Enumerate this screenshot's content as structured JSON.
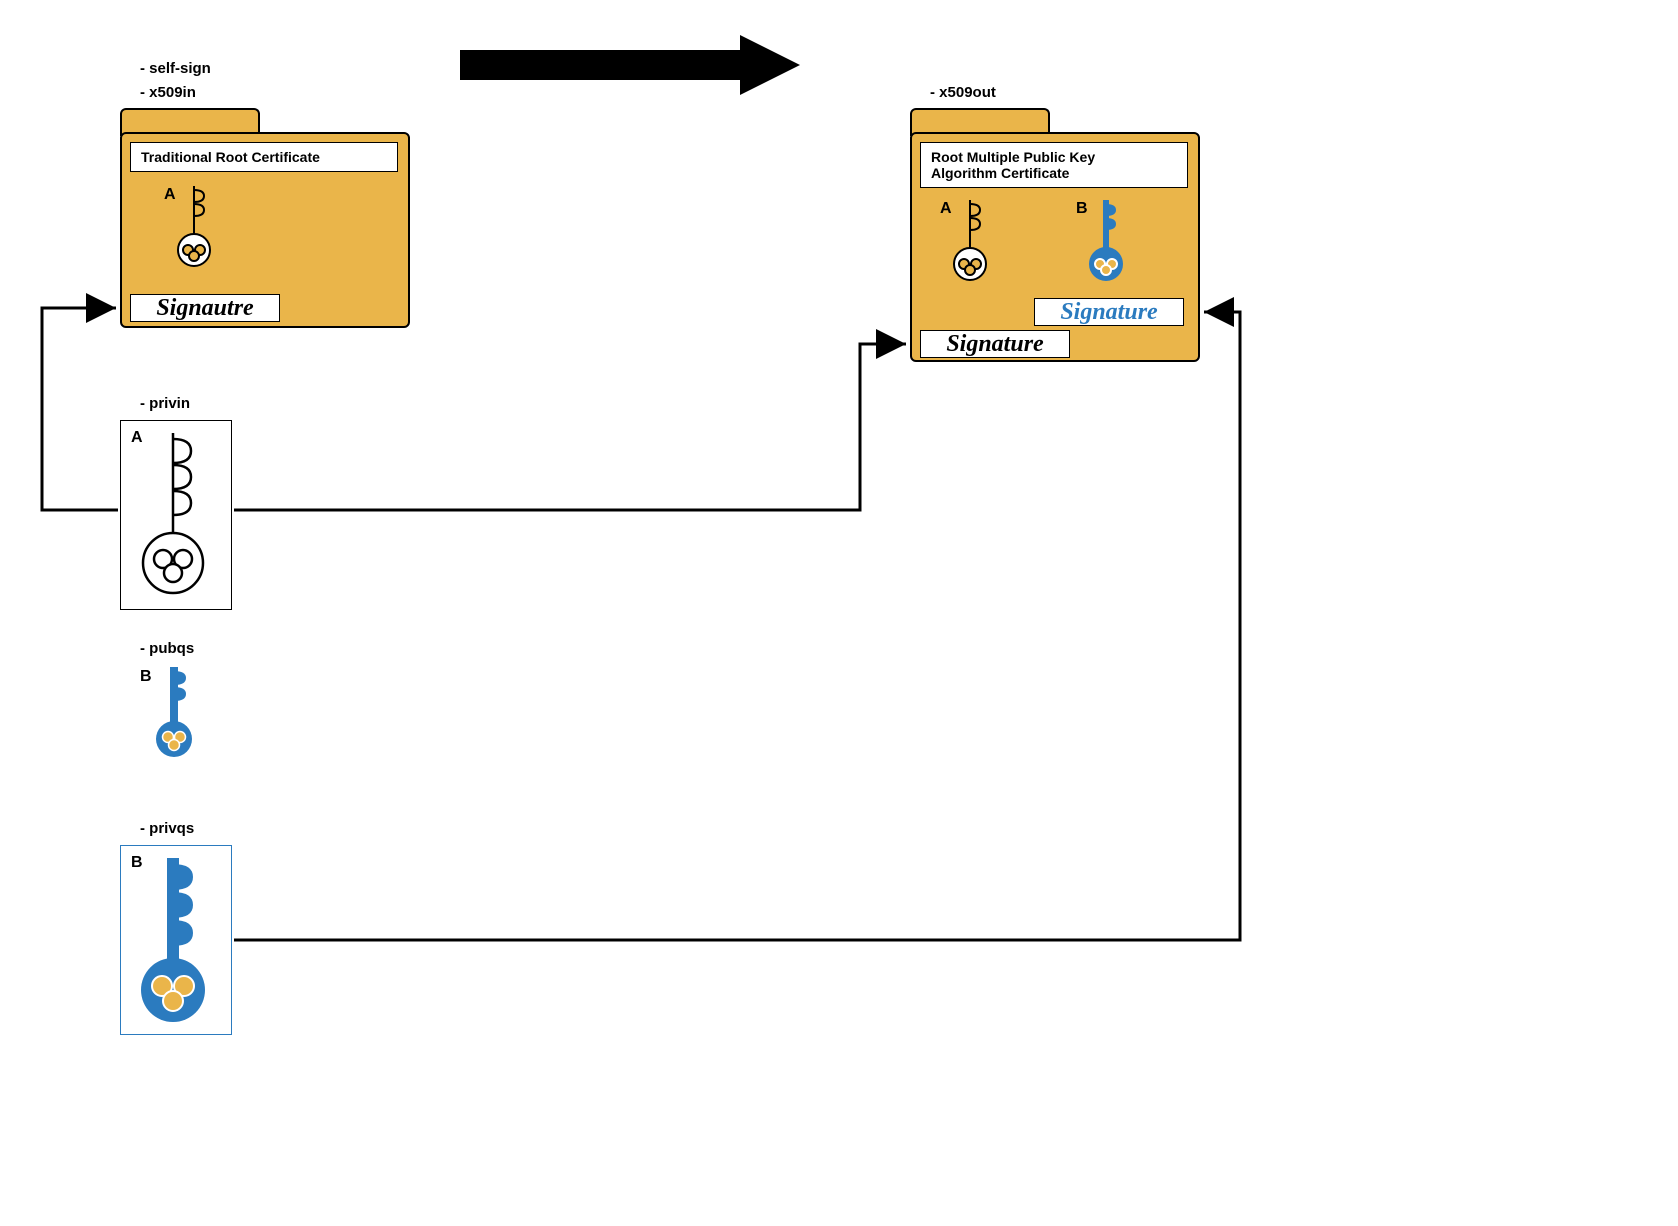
{
  "labels": {
    "self_sign": "- self-sign",
    "x509in": "- x509in",
    "x509out": "- x509out",
    "privin": "- privin",
    "pubqs": "- pubqs",
    "privqs": "- privqs"
  },
  "left_cert": {
    "title": "Traditional Root Certificate",
    "key_A_label": "A",
    "signature": "Signautre"
  },
  "right_cert": {
    "title_line1": "Root Multiple Public Key",
    "title_line2": "Algorithm Certificate",
    "key_A_label": "A",
    "key_B_label": "B",
    "signature_black": "Signature",
    "signature_blue": "Signature"
  },
  "privin_key_label": "A",
  "pubqs_key_label": "B",
  "privqs_key_label": "B",
  "colors": {
    "folder": "#eab54a",
    "blue": "#2b7bbf",
    "yellow_ball": "#eab54a"
  }
}
